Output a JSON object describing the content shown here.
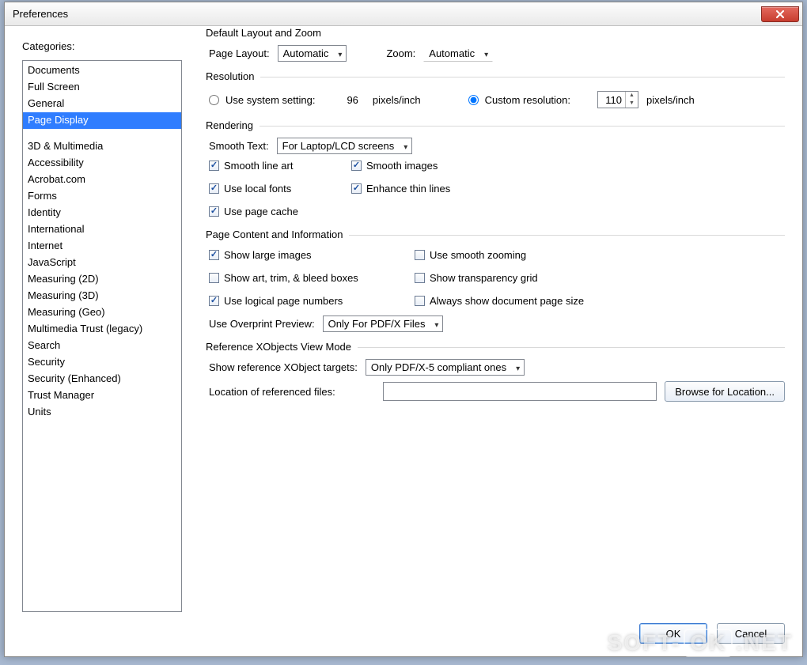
{
  "window": {
    "title": "Preferences"
  },
  "sidebar": {
    "label": "Categories:",
    "selectedIndex": 3,
    "group1": [
      "Documents",
      "Full Screen",
      "General",
      "Page Display"
    ],
    "group2": [
      "3D & Multimedia",
      "Accessibility",
      "Acrobat.com",
      "Forms",
      "Identity",
      "International",
      "Internet",
      "JavaScript",
      "Measuring (2D)",
      "Measuring (3D)",
      "Measuring (Geo)",
      "Multimedia Trust (legacy)",
      "Search",
      "Security",
      "Security (Enhanced)",
      "Trust Manager",
      "Units"
    ]
  },
  "layoutZoom": {
    "title": "Default Layout and Zoom",
    "pageLayoutLabel": "Page Layout:",
    "pageLayoutValue": "Automatic",
    "zoomLabel": "Zoom:",
    "zoomValue": "Automatic"
  },
  "resolution": {
    "title": "Resolution",
    "useSystemLabel": "Use system setting:",
    "systemValue": "96",
    "systemUnit": "pixels/inch",
    "customLabel": "Custom resolution:",
    "customValue": "110",
    "customUnit": "pixels/inch",
    "selected": "custom"
  },
  "rendering": {
    "title": "Rendering",
    "smoothTextLabel": "Smooth Text:",
    "smoothTextValue": "For Laptop/LCD screens",
    "checks": {
      "smoothLineArt": {
        "label": "Smooth line art",
        "checked": true
      },
      "smoothImages": {
        "label": "Smooth images",
        "checked": true
      },
      "useLocalFonts": {
        "label": "Use local fonts",
        "checked": true
      },
      "enhanceThin": {
        "label": "Enhance thin lines",
        "checked": true
      },
      "usePageCache": {
        "label": "Use page cache",
        "checked": true
      }
    }
  },
  "pageContent": {
    "title": "Page Content and Information",
    "checks": {
      "showLargeImages": {
        "label": "Show large images",
        "checked": true
      },
      "useSmoothZoom": {
        "label": "Use smooth zooming",
        "checked": false
      },
      "showArtTrim": {
        "label": "Show art, trim, & bleed boxes",
        "checked": false
      },
      "showTransparency": {
        "label": "Show transparency grid",
        "checked": false
      },
      "useLogicalPageNum": {
        "label": "Use logical page numbers",
        "checked": true
      },
      "alwaysShowDocSize": {
        "label": "Always show document page size",
        "checked": false
      }
    },
    "overprintLabel": "Use Overprint Preview:",
    "overprintValue": "Only For PDF/X Files"
  },
  "xobjects": {
    "title": "Reference XObjects View Mode",
    "targetsLabel": "Show reference XObject targets:",
    "targetsValue": "Only PDF/X-5 compliant ones",
    "locationLabel": "Location of referenced files:",
    "locationValue": "",
    "browseLabel": "Browse for Location..."
  },
  "footer": {
    "ok": "OK",
    "cancel": "Cancel"
  },
  "watermark": {
    "left": "SOFT-",
    "mid": "OK",
    "right": ".NET"
  }
}
